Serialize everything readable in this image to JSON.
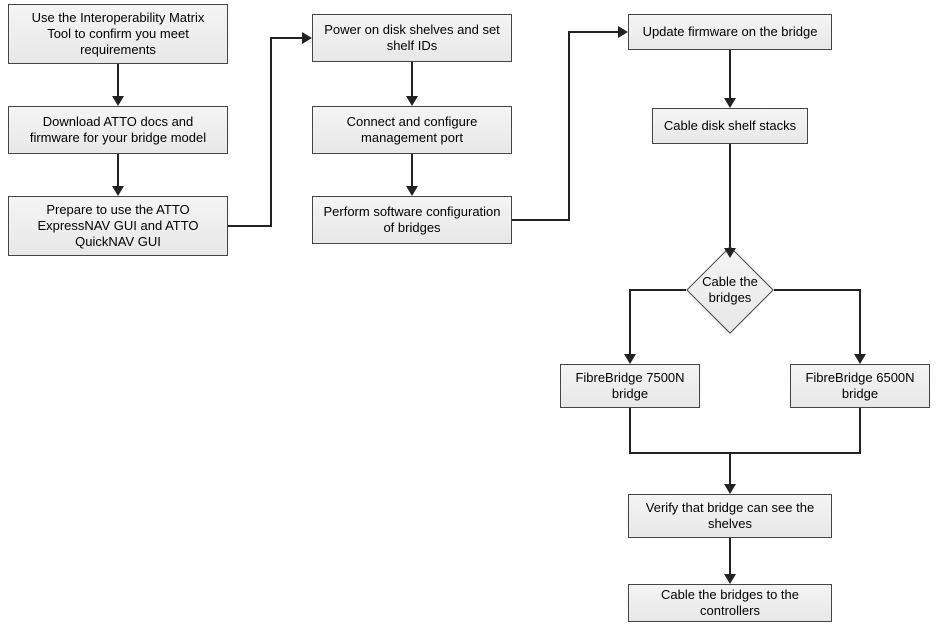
{
  "chart_data": {
    "type": "flowchart",
    "nodes": [
      {
        "id": "n_interop",
        "kind": "process",
        "text": "Use the Interoperability Matrix Tool to confirm you meet requirements"
      },
      {
        "id": "n_download",
        "kind": "process",
        "text": "Download ATTO docs and firmware for your bridge model"
      },
      {
        "id": "n_prepare",
        "kind": "process",
        "text": "Prepare to use the ATTO ExpressNAV GUI and ATTO QuickNAV GUI"
      },
      {
        "id": "n_poweron",
        "kind": "process",
        "text": "Power on disk shelves and set shelf IDs"
      },
      {
        "id": "n_connect",
        "kind": "process",
        "text": "Connect and configure management port"
      },
      {
        "id": "n_swconfig",
        "kind": "process",
        "text": "Perform software configuration of bridges"
      },
      {
        "id": "n_firmware",
        "kind": "process",
        "text": "Update firmware on the bridge"
      },
      {
        "id": "n_cableshelf",
        "kind": "process",
        "text": "Cable disk shelf stacks"
      },
      {
        "id": "n_decision",
        "kind": "decision",
        "text": "Cable the bridges"
      },
      {
        "id": "n_7500",
        "kind": "process",
        "text": "FibreBridge 7500N bridge"
      },
      {
        "id": "n_6500",
        "kind": "process",
        "text": "FibreBridge 6500N bridge"
      },
      {
        "id": "n_verify",
        "kind": "process",
        "text": "Verify that bridge can see the shelves"
      },
      {
        "id": "n_cablectrl",
        "kind": "process",
        "text": "Cable the bridges to the controllers"
      }
    ],
    "edges": [
      {
        "from": "n_interop",
        "to": "n_download"
      },
      {
        "from": "n_download",
        "to": "n_prepare"
      },
      {
        "from": "n_prepare",
        "to": "n_poweron"
      },
      {
        "from": "n_poweron",
        "to": "n_connect"
      },
      {
        "from": "n_connect",
        "to": "n_swconfig"
      },
      {
        "from": "n_swconfig",
        "to": "n_firmware"
      },
      {
        "from": "n_firmware",
        "to": "n_cableshelf"
      },
      {
        "from": "n_cableshelf",
        "to": "n_decision"
      },
      {
        "from": "n_decision",
        "to": "n_7500"
      },
      {
        "from": "n_decision",
        "to": "n_6500"
      },
      {
        "from": "n_7500",
        "to": "n_verify"
      },
      {
        "from": "n_6500",
        "to": "n_verify"
      },
      {
        "from": "n_verify",
        "to": "n_cablectrl"
      }
    ]
  }
}
